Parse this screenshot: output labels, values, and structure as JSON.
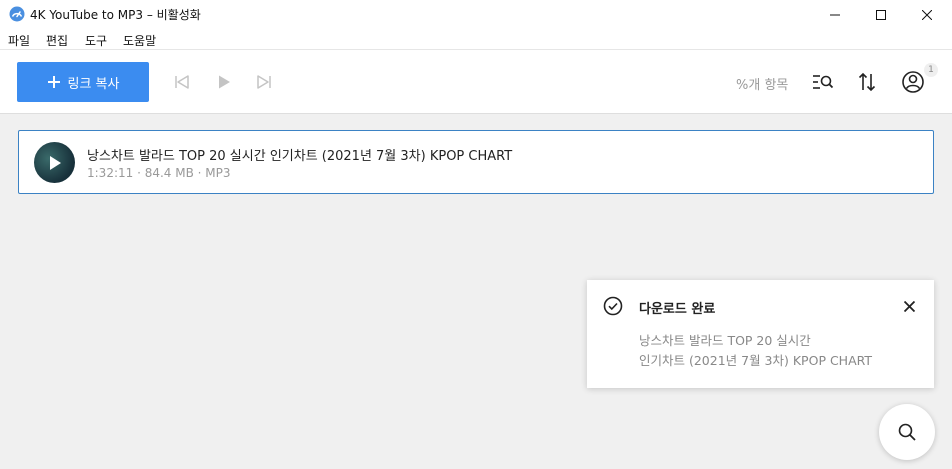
{
  "window": {
    "title": "4K YouTube to MP3 – 비활성화"
  },
  "menu": {
    "items": [
      "파일",
      "편집",
      "도구",
      "도움말"
    ]
  },
  "toolbar": {
    "copy_link_label": "링크 복사",
    "items_count_label": "%개 항목",
    "account_badge": "1"
  },
  "track": {
    "title": "낭스차트 발라드 TOP 20   실시간 인기차트 (2021년 7월 3차)   KPOP CHART",
    "meta": "1:32:11 · 84.4 MB · MP3"
  },
  "toast": {
    "title": "다운로드 완료",
    "line1": "낭스차트 발라드 TOP 20 실시간",
    "line2": "인기차트 (2021년 7월 3차) KPOP CHART"
  },
  "colors": {
    "accent": "#3b8cf0",
    "selection_border": "#3b82c4",
    "background": "#f0f0f0"
  },
  "icons": {
    "app": "app-logo-icon",
    "minimize": "minimize-icon",
    "maximize": "maximize-icon",
    "close": "close-icon",
    "plus": "plus-icon",
    "skip_prev": "skip-previous-icon",
    "play": "play-icon",
    "skip_next": "skip-next-icon",
    "search_list": "search-list-icon",
    "sort": "sort-icon",
    "account": "account-icon",
    "check": "check-circle-icon",
    "search": "search-icon"
  }
}
